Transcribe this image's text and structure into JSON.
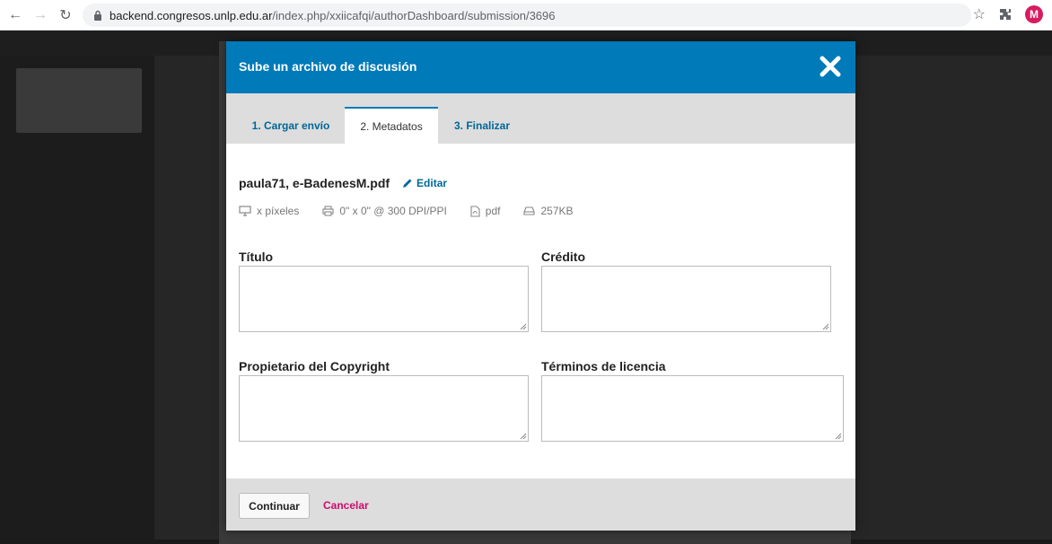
{
  "browser": {
    "url_host": "backend.congresos.unlp.edu.ar",
    "url_path": "/index.php/xxiicafqi/authorDashboard/submission/3696",
    "profile_initial": "M"
  },
  "modal": {
    "title": "Sube un archivo de discusión",
    "tabs": [
      {
        "label": "1. Cargar envío"
      },
      {
        "label": "2. Metadatos"
      },
      {
        "label": "3. Finalizar"
      }
    ],
    "file": {
      "name": "paula71, e-BadenesM.pdf",
      "edit_label": "Editar",
      "dimensions": "x píxeles",
      "print_size": "0\" x 0\" @ 300 DPI/PPI",
      "type": "pdf",
      "size": "257KB"
    },
    "fields": {
      "title_label": "Título",
      "credit_label": "Crédito",
      "copyright_label": "Propietario del Copyright",
      "license_label": "Términos de licencia"
    },
    "footer": {
      "continue_label": "Continuar",
      "cancel_label": "Cancelar"
    }
  },
  "colors": {
    "header": "#007ab8",
    "link": "#006798",
    "cancel": "#d00a6c"
  }
}
